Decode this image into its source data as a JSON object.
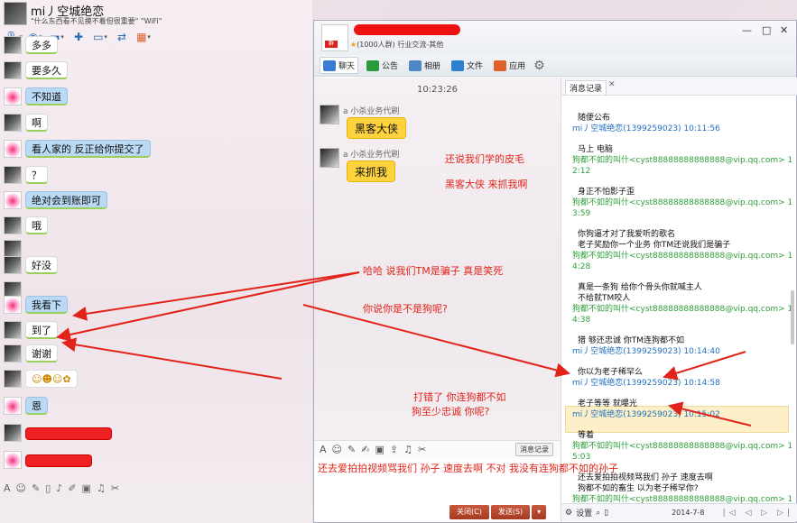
{
  "left": {
    "title": "mi丿空城绝恋",
    "signature": "\"什么东西看不见摸不着但很重要\"  \"WiFi\"",
    "messages": [
      {
        "side": "me",
        "text": "多多",
        "style": "white"
      },
      {
        "side": "me",
        "text": "要多久",
        "style": "white"
      },
      {
        "side": "them",
        "text": "不知道",
        "style": "blue"
      },
      {
        "side": "me",
        "text": "啊",
        "style": "white"
      },
      {
        "side": "them",
        "text": "看人家的 反正给你提交了",
        "style": "blue"
      },
      {
        "side": "me",
        "text": "？",
        "style": "white"
      },
      {
        "side": "them",
        "text": "绝对会到账即可",
        "style": "blue"
      },
      {
        "side": "me",
        "text": "哦",
        "style": "white"
      },
      {
        "side": "me",
        "text": "",
        "style": "none"
      },
      {
        "side": "me",
        "text": "好没",
        "style": "white"
      },
      {
        "side": "me",
        "text": "",
        "style": "none"
      },
      {
        "side": "them",
        "text": "我看下",
        "style": "blue"
      },
      {
        "side": "me",
        "text": "到了",
        "style": "white"
      },
      {
        "side": "me",
        "text": "谢谢",
        "style": "white"
      },
      {
        "side": "me",
        "text": "☺☻☺✿",
        "style": "emoji"
      },
      {
        "side": "them",
        "text": "恩",
        "style": "blue"
      },
      {
        "side": "me",
        "text": "",
        "style": "red"
      },
      {
        "side": "them",
        "text": "",
        "style": "red"
      }
    ]
  },
  "right": {
    "group_badge": "群",
    "group_desc": "(1000人群) 行业交流-其他",
    "window_controls": [
      "—",
      "□",
      "✕"
    ],
    "tabs": [
      {
        "label": "聊天",
        "icon": "chat-icon",
        "color": "#3a7bd5"
      },
      {
        "label": "公告",
        "icon": "flag-icon",
        "color": "#2c9a3a"
      },
      {
        "label": "相册",
        "icon": "photo-icon",
        "color": "#4f86c6"
      },
      {
        "label": "文件",
        "icon": "folder-icon",
        "color": "#2f7fd0"
      },
      {
        "label": "应用",
        "icon": "apps-icon",
        "color": "#e0622b"
      }
    ],
    "timestamp": "10:23:26",
    "group_messages": [
      {
        "sender": "a 小杀业务代刷",
        "text": "黑客大侠"
      },
      {
        "sender": "a 小杀业务代刷",
        "text": "来抓我"
      }
    ],
    "record_button": "消息记录",
    "close_button": "关闭(C)",
    "send_button": "发送(S)",
    "history_tab": "消息记录",
    "history": [
      {
        "type": "msg",
        "text": "随便公布"
      },
      {
        "type": "hdr-blue",
        "text": "mi丿空城绝恋(1399259023) 10:11:56"
      },
      {
        "type": "msg",
        "text": "马上 电脑"
      },
      {
        "type": "hdr-green",
        "text": "狗都不如的叫什<cyst88888888888888@vip.qq.com> 10:1"
      },
      {
        "type": "hdr-green",
        "text": "2:12"
      },
      {
        "type": "msg",
        "text": "身正不怕影子歪"
      },
      {
        "type": "hdr-green",
        "text": "狗都不如的叫什<cyst88888888888888@vip.qq.com> 10:1"
      },
      {
        "type": "hdr-green",
        "text": "3:59"
      },
      {
        "type": "msg",
        "text": "你狗逼才对了我爱听的歌名"
      },
      {
        "type": "msg",
        "text": "老子奖励你一个业务 你TM还说我们是骗子"
      },
      {
        "type": "hdr-green",
        "text": "狗都不如的叫什<cyst88888888888888@vip.qq.com> 10:1"
      },
      {
        "type": "hdr-green",
        "text": "4:28"
      },
      {
        "type": "msg",
        "text": "真是一条狗 给你个骨头你就喊主人"
      },
      {
        "type": "msg",
        "text": "不给就TM咬人"
      },
      {
        "type": "hdr-green",
        "text": "狗都不如的叫什<cyst88888888888888@vip.qq.com> 10:1"
      },
      {
        "type": "hdr-green",
        "text": "4:38"
      },
      {
        "type": "msg",
        "text": "猎 够还忠诚  你TM连狗都不如"
      },
      {
        "type": "hdr-blue",
        "text": "mi丿空城绝恋(1399259023) 10:14:40"
      },
      {
        "type": "msg",
        "text": "你以为老子稀罕么"
      },
      {
        "type": "hdr-blue",
        "text": "mi丿空城绝恋(1399259023) 10:14:58"
      },
      {
        "type": "msg",
        "text": "老子等等   就曝光"
      },
      {
        "type": "hdr-blue",
        "text": "mi丿空城绝恋(1399259023) 10:15:02"
      },
      {
        "type": "msg",
        "text": "等着"
      },
      {
        "type": "hdr-green",
        "text": "狗都不如的叫什<cyst88888888888888@vip.qq.com> 10:1"
      },
      {
        "type": "hdr-green",
        "text": "5:03"
      },
      {
        "type": "msg",
        "text": "还去爱拍拍视频骂我们 孙子 速度去啊"
      },
      {
        "type": "msg",
        "text": "狗都不如的畜生 以为老子稀罕你?"
      },
      {
        "type": "hdr-green",
        "text": "狗都不如的叫什<cyst88888888888888@vip.qq.com> 10:1"
      },
      {
        "type": "hdr-green",
        "text": "5:06"
      }
    ],
    "history_footer": {
      "settings": "设置",
      "date": "2014-7-8",
      "nav": "|◁ ◁ ▷ ▷|"
    }
  },
  "annotations": [
    {
      "id": "ann-1",
      "text": "还说我们学的皮毛"
    },
    {
      "id": "ann-2",
      "text": "黑客大侠  来抓我啊"
    },
    {
      "id": "ann-3",
      "text": "哈哈 说我们TM是骗子 真是笑死"
    },
    {
      "id": "ann-4",
      "text": "你说你是不是狗呢?"
    },
    {
      "id": "ann-5",
      "text": "打错了  你连狗都不如"
    },
    {
      "id": "ann-6",
      "text": "狗至少忠诚 你呢?"
    },
    {
      "id": "ann-7",
      "text": "还去爱拍拍视频骂我们  孙子  速度去啊   不对  我没有连狗都不如的孙子"
    }
  ]
}
